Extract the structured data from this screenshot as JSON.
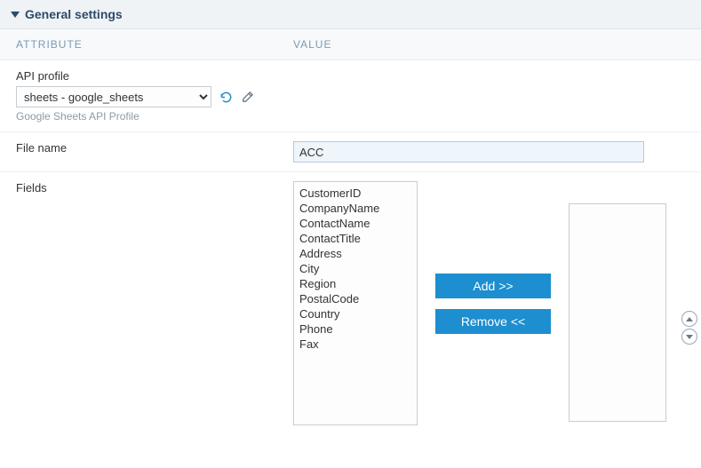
{
  "section": {
    "title": "General settings"
  },
  "columns": {
    "attribute": "ATTRIBUTE",
    "value": "VALUE"
  },
  "api_profile": {
    "label": "API profile",
    "selected": "sheets - google_sheets",
    "hint": "Google Sheets API Profile"
  },
  "file_name": {
    "label": "File name",
    "value": "ACC"
  },
  "fields": {
    "label": "Fields",
    "available": [
      "CustomerID",
      "CompanyName",
      "ContactName",
      "ContactTitle",
      "Address",
      "City",
      "Region",
      "PostalCode",
      "Country",
      "Phone",
      "Fax"
    ],
    "selected": []
  },
  "buttons": {
    "add": "Add >>",
    "remove": "Remove  <<"
  }
}
